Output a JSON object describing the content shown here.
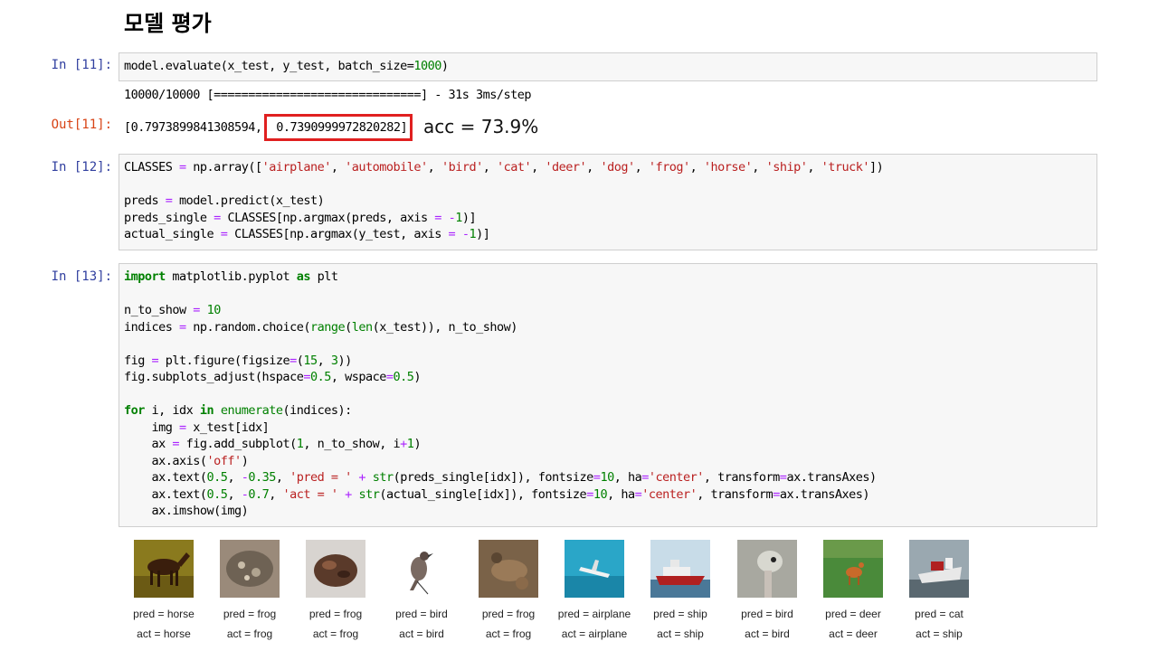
{
  "heading": "모델 평가",
  "cells": {
    "in11": {
      "prompt": "In [11]:",
      "code_parts": [
        "model.evaluate(x_test, y_test, batch_size=",
        "1000",
        ")"
      ]
    },
    "stream11": "10000/10000 [==============================] - 31s 3ms/step",
    "out11": {
      "prompt": "Out[11]:",
      "loss": "[0.7973899841308594,",
      "accuracy": " 0.7390999972820282]",
      "annotation": "acc = 73.9%"
    },
    "in12": {
      "prompt": "In [12]:"
    },
    "in13": {
      "prompt": "In [13]:"
    }
  },
  "thumbnails": [
    {
      "pred": "pred = horse",
      "act": "act = horse",
      "subject": "horse-image"
    },
    {
      "pred": "pred = frog",
      "act": "act = frog",
      "subject": "frog-image"
    },
    {
      "pred": "pred = frog",
      "act": "act = frog",
      "subject": "frog-image"
    },
    {
      "pred": "pred = bird",
      "act": "act = bird",
      "subject": "bird-image"
    },
    {
      "pred": "pred = frog",
      "act": "act = frog",
      "subject": "frog-image"
    },
    {
      "pred": "pred = airplane",
      "act": "act = airplane",
      "subject": "airplane-image"
    },
    {
      "pred": "pred = ship",
      "act": "act = ship",
      "subject": "ship-image"
    },
    {
      "pred": "pred = bird",
      "act": "act = bird",
      "subject": "bird-image"
    },
    {
      "pred": "pred = deer",
      "act": "act = deer",
      "subject": "deer-image"
    },
    {
      "pred": "pred = cat",
      "act": "act = ship",
      "subject": "ship-image"
    }
  ],
  "colors": {
    "highlight": "#e02020",
    "in_prompt": "#303f9f",
    "out_prompt": "#d84315",
    "cell_bg": "#f7f7f7"
  }
}
